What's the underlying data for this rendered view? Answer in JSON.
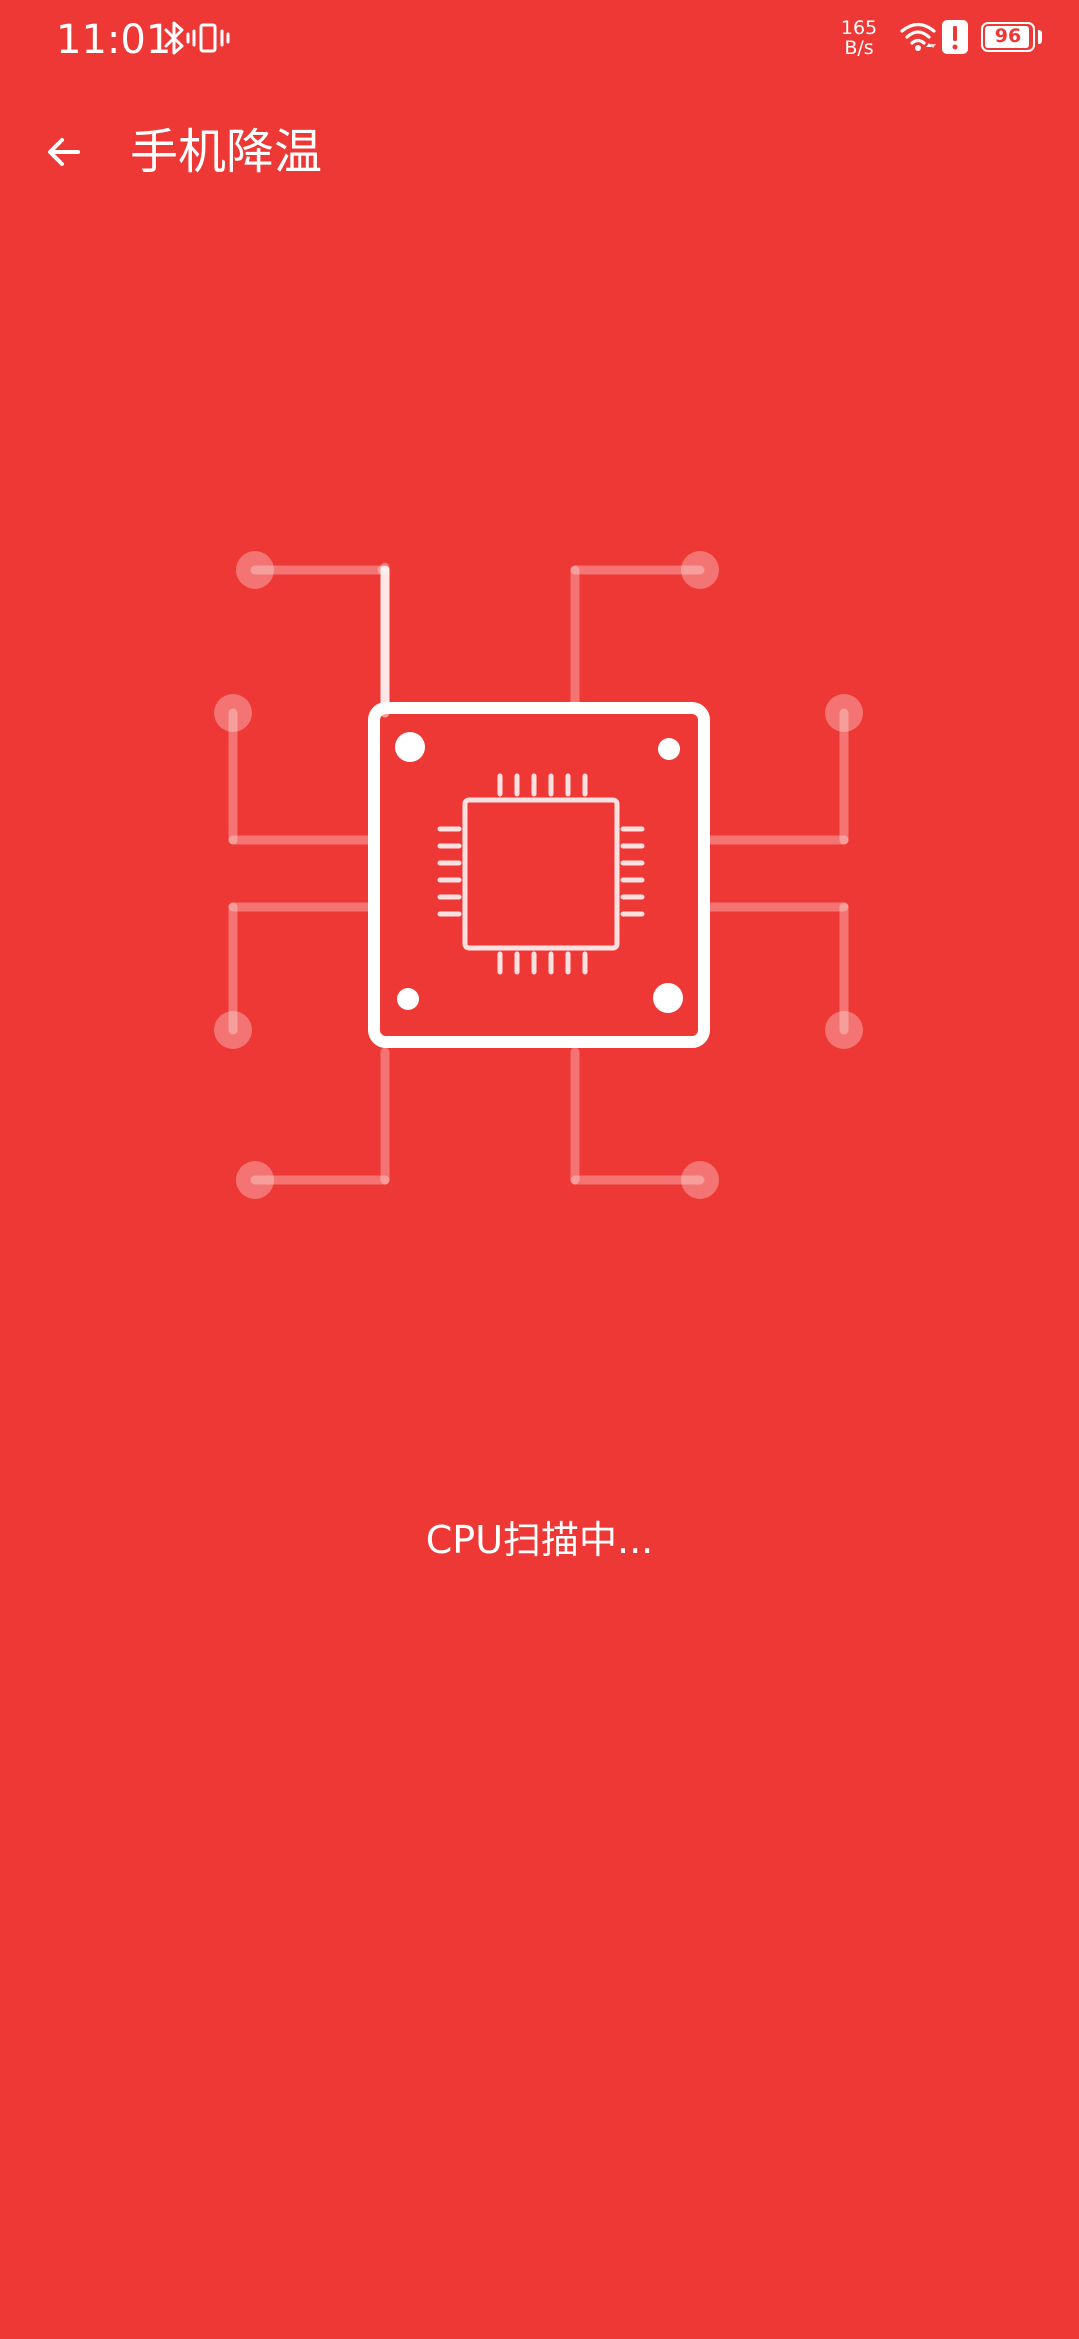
{
  "status_bar": {
    "time": "11:01",
    "net_speed_value": "165",
    "net_speed_unit": "B/s",
    "battery_level": "96",
    "icons": [
      "bluetooth-icon",
      "vibrate-icon",
      "wifi-icon",
      "alert-icon",
      "battery-icon"
    ]
  },
  "app_bar": {
    "back_icon": "arrow-left-icon",
    "title": "手机降温"
  },
  "main": {
    "illustration_icon": "cpu-chip-icon",
    "scan_status": "CPU扫描中..."
  },
  "colors": {
    "background": "#EE3835",
    "foreground": "#FFFFFF"
  }
}
